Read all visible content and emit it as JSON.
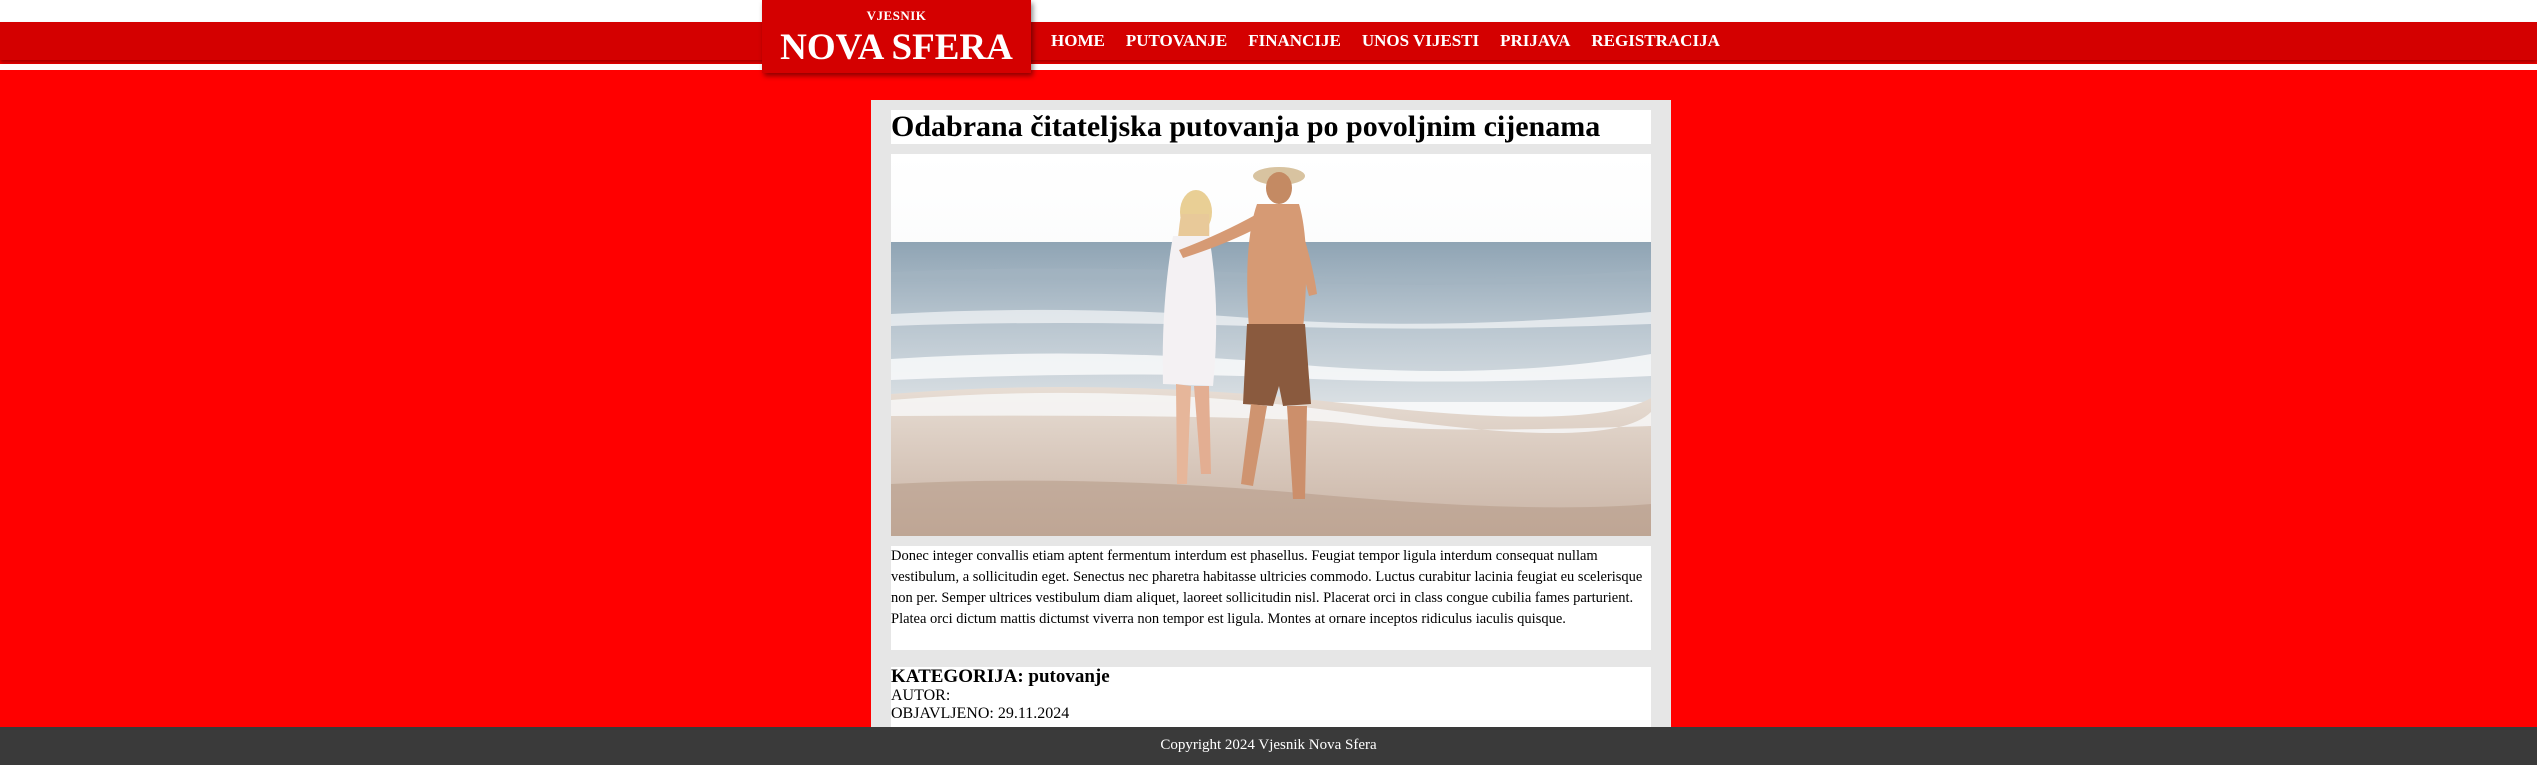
{
  "header": {
    "logo_sub": "VJESNIK",
    "logo_main": "NOVA SFERA",
    "nav": [
      "HOME",
      "PUTOVANJE",
      "FINANCIJE",
      "UNOS VIJESTI",
      "PRIJAVA",
      "REGISTRACIJA"
    ]
  },
  "article": {
    "title": "Odabrana čitateljska putovanja po povoljnim cijenama",
    "image_subject": "couple-walking-on-beach",
    "body": "Donec integer convallis etiam aptent fermentum interdum est phasellus. Feugiat tempor ligula interdum consequat nullam vestibulum, a sollicitudin eget. Senectus nec pharetra habitasse ultricies commodo. Luctus curabitur lacinia feugiat eu scelerisque non per. Semper ultrices vestibulum diam aliquet, laoreet sollicitudin nisl. Placerat orci in class congue cubilia fames parturient. Platea orci dictum mattis dictumst viverra non tempor est ligula. Montes at ornare inceptos ridiculus iaculis quisque.",
    "category_line": "KATEGORIJA: putovanje",
    "author_line": "AUTOR:",
    "published_line": "OBJAVLJENO: 29.11.2024"
  },
  "footer": {
    "copyright": "Copyright 2024 Vjesnik Nova Sfera"
  },
  "colors": {
    "page_background": "#ff0000",
    "nav_background": "#d40000",
    "article_background": "#e6e6e6",
    "footer_background": "#3a3a3a"
  }
}
